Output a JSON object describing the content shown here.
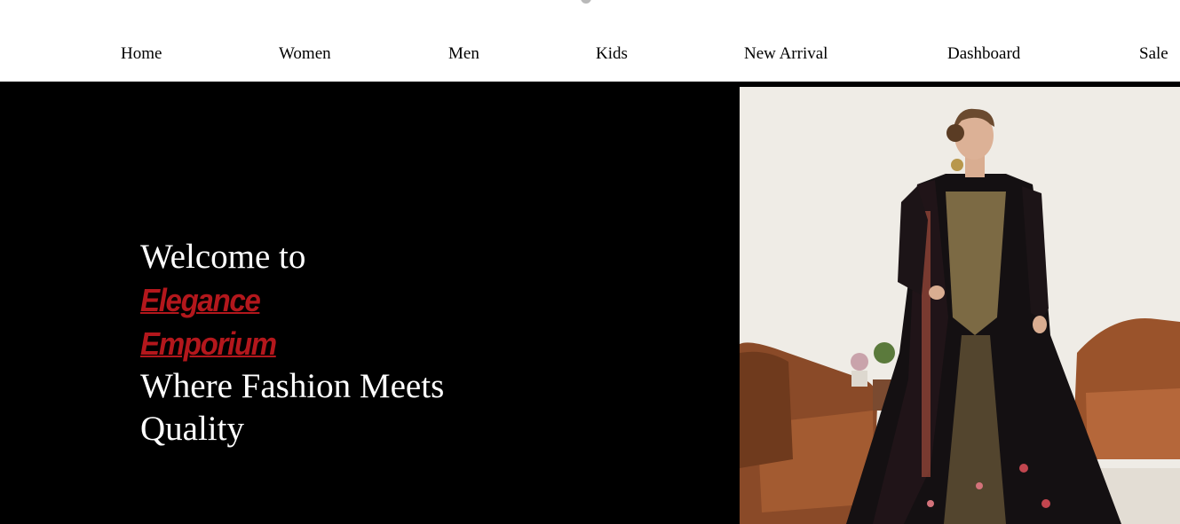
{
  "nav": {
    "items": [
      "Home",
      "Women",
      "Men",
      "Kids",
      "New Arrival",
      "Dashboard",
      "Sale"
    ]
  },
  "hero": {
    "welcome": "Welcome to",
    "brand_line1": "Elegance",
    "brand_line2": "Emporium",
    "tagline": "Where Fashion Meets Quality"
  },
  "colors": {
    "hero_bg": "#000000",
    "brand_red": "#b3171c",
    "nav_bg": "#ffffff"
  },
  "icons": {
    "logo": "logo-icon"
  }
}
